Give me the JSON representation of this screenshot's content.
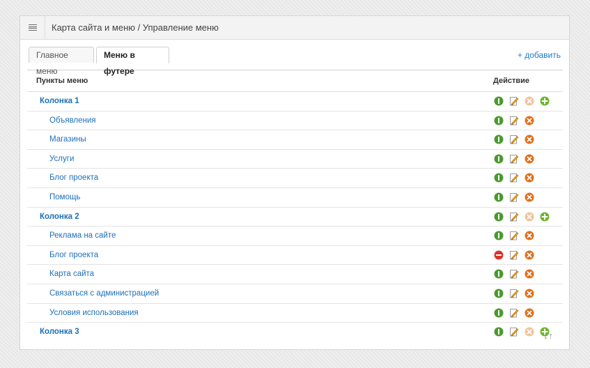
{
  "header": {
    "title": "Карта сайта и меню / Управление меню"
  },
  "tabs": [
    {
      "label": "Главное меню",
      "active": false
    },
    {
      "label": "Меню в футере",
      "active": true
    }
  ],
  "add_link": "+ добавить",
  "table": {
    "col_items": "Пункты меню",
    "col_action": "Действие",
    "rows": [
      {
        "label": "Колонка 1",
        "type": "group",
        "status": "enabled",
        "delete_enabled": false,
        "can_add": true
      },
      {
        "label": "Объявления",
        "type": "child",
        "status": "enabled",
        "delete_enabled": true,
        "can_add": false
      },
      {
        "label": "Магазины",
        "type": "child",
        "status": "enabled",
        "delete_enabled": true,
        "can_add": false
      },
      {
        "label": "Услуги",
        "type": "child",
        "status": "enabled",
        "delete_enabled": true,
        "can_add": false
      },
      {
        "label": "Блог проекта",
        "type": "child",
        "status": "enabled",
        "delete_enabled": true,
        "can_add": false
      },
      {
        "label": "Помощь",
        "type": "child",
        "status": "enabled",
        "delete_enabled": true,
        "can_add": false
      },
      {
        "label": "Колонка 2",
        "type": "group",
        "status": "enabled",
        "delete_enabled": false,
        "can_add": true
      },
      {
        "label": "Реклама на сайте",
        "type": "child",
        "status": "enabled",
        "delete_enabled": true,
        "can_add": false
      },
      {
        "label": "Блог проекта",
        "type": "child",
        "status": "disabled",
        "delete_enabled": true,
        "can_add": false
      },
      {
        "label": "Карта сайта",
        "type": "child",
        "status": "enabled",
        "delete_enabled": true,
        "can_add": false
      },
      {
        "label": "Связаться с администрацией",
        "type": "child",
        "status": "enabled",
        "delete_enabled": true,
        "can_add": false
      },
      {
        "label": "Условия использования",
        "type": "child",
        "status": "enabled",
        "delete_enabled": true,
        "can_add": false
      },
      {
        "label": "Колонка 3",
        "type": "group",
        "status": "enabled",
        "delete_enabled": false,
        "can_add": true
      }
    ]
  },
  "sort_label": "↓↑",
  "icons": {
    "toggle": "toggle-enabled-icon",
    "toggle_off": "toggle-disabled-icon",
    "edit": "edit-icon",
    "delete": "delete-icon",
    "add": "add-child-icon",
    "menu": "hamburger-menu-icon"
  },
  "colors": {
    "link": "#1d6fb8",
    "enabled": "#4a9a2e",
    "disabled": "#d9342b",
    "delete": "#e0701b",
    "delete_faded": "#f2c39c",
    "add": "#6bb52a"
  }
}
